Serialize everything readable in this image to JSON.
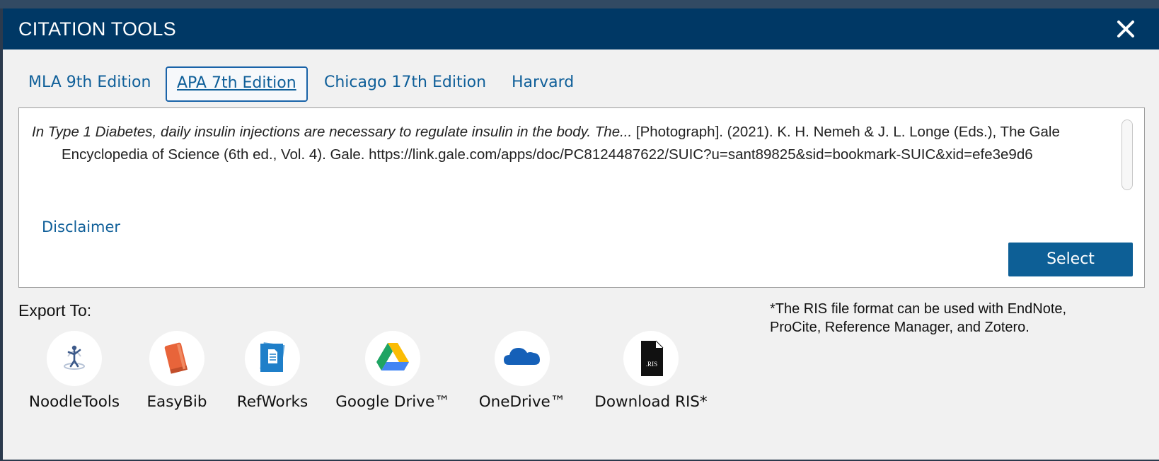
{
  "dialog": {
    "title": "CITATION TOOLS",
    "close_icon": "close-icon"
  },
  "tabs": [
    {
      "label": "MLA 9th Edition",
      "active": false
    },
    {
      "label": "APA 7th Edition",
      "active": true
    },
    {
      "label": "Chicago 17th Edition",
      "active": false
    },
    {
      "label": "Harvard",
      "active": false
    }
  ],
  "citation": {
    "title_italic": "In Type 1 Diabetes, daily insulin injections are necessary to regulate insulin in the body. The...",
    "rest": " [Photograph]. (2021). K. H. Nemeh & J. L. Longe (Eds.), The Gale Encyclopedia of Science (6th ed., Vol. 4). Gale. https://link.gale.com/apps/doc/PC8124487622/SUIC?u=sant89825&sid=bookmark-SUIC&xid=efe3e9d6",
    "disclaimer_label": "Disclaimer",
    "select_label": "Select"
  },
  "export": {
    "label": "Export To:",
    "ris_note": "*The RIS file format can be used with EndNote, ProCite, Reference Manager, and Zotero.",
    "items": [
      {
        "label": "NoodleTools",
        "icon": "noodletools-icon"
      },
      {
        "label": "EasyBib",
        "icon": "easybib-icon"
      },
      {
        "label": "RefWorks",
        "icon": "refworks-icon"
      },
      {
        "label": "Google Drive™",
        "icon": "google-drive-icon"
      },
      {
        "label": "OneDrive™",
        "icon": "onedrive-icon"
      },
      {
        "label": "Download RIS*",
        "icon": "ris-file-icon",
        "icon_text": ".RIS"
      }
    ]
  },
  "colors": {
    "header": "#003865",
    "link": "#0f5f99",
    "button": "#0d5f96",
    "easybib": "#e8643a",
    "refworks": "#1f7fc9",
    "onedrive": "#1560b8"
  }
}
